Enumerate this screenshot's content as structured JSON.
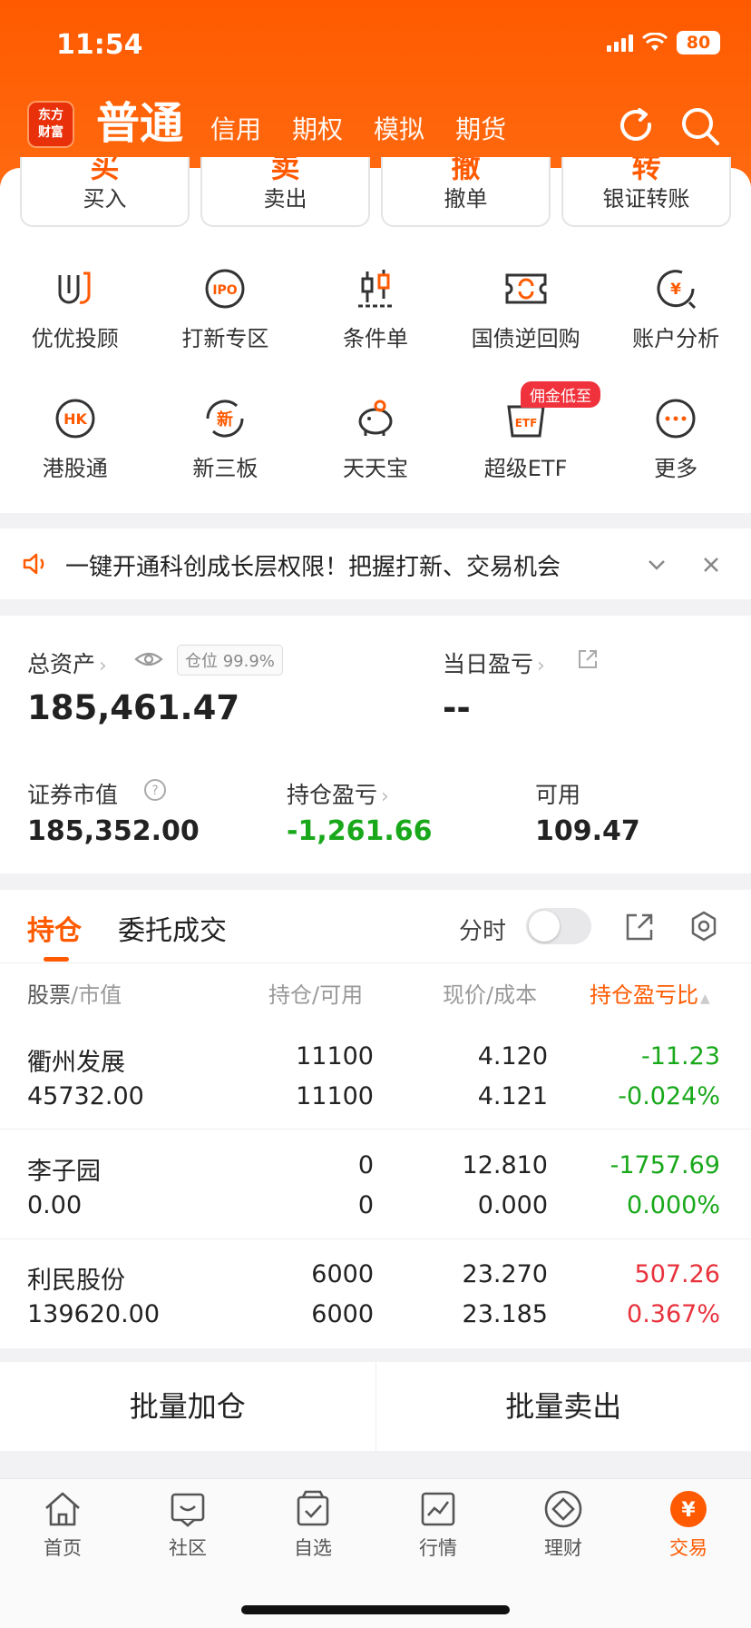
{
  "status": {
    "time": "11:54",
    "battery": "80"
  },
  "brand": {
    "line1": "东方",
    "line2": "财富"
  },
  "header": {
    "tabs": [
      "普通",
      "信用",
      "期权",
      "模拟",
      "期货"
    ]
  },
  "trade_buttons": [
    {
      "glyph": "买",
      "label": "买入"
    },
    {
      "glyph": "卖",
      "label": "卖出"
    },
    {
      "glyph": "撤",
      "label": "撤单"
    },
    {
      "glyph": "转",
      "label": "银证转账"
    }
  ],
  "features": [
    {
      "label": "优优投顾",
      "icon": "advisor-icon"
    },
    {
      "label": "打新专区",
      "icon": "ipo-icon",
      "icon_text": "IPO"
    },
    {
      "label": "条件单",
      "icon": "candlestick-icon"
    },
    {
      "label": "国债逆回购",
      "icon": "repo-icon"
    },
    {
      "label": "账户分析",
      "icon": "account-analysis-icon",
      "icon_text": "¥"
    },
    {
      "label": "港股通",
      "icon": "hk-icon",
      "icon_text": "HK"
    },
    {
      "label": "新三板",
      "icon": "new-third-board-icon",
      "icon_text": "新"
    },
    {
      "label": "天天宝",
      "icon": "piggy-bank-icon"
    },
    {
      "label": "超级ETF",
      "icon": "etf-icon",
      "icon_text": "ETF"
    },
    {
      "label": "更多",
      "icon": "more-icon"
    }
  ],
  "etf_badge": "佣金低至",
  "notice": {
    "text": "一键开通科创成长层权限！把握打新、交易机会"
  },
  "assets": {
    "total_label": "总资产",
    "position_tag": "仓位 99.9%",
    "total_value": "185,461.47",
    "daily_pl_label": "当日盈亏",
    "daily_pl_value": "--",
    "market_value_label": "证券市值",
    "market_value": "185,352.00",
    "holding_pl_label": "持仓盈亏",
    "holding_pl": "-1,261.66",
    "available_label": "可用",
    "available": "109.47"
  },
  "holdings_tabs": {
    "holdings": "持仓",
    "orders": "委托成交",
    "intraday": "分时"
  },
  "table": {
    "headers": {
      "stock": "股票",
      "market_value": "市值",
      "position": "持仓",
      "available": "可用",
      "price": "现价",
      "cost": "成本",
      "pl_ratio": "持仓盈亏比"
    },
    "rows": [
      {
        "name": "衢州发展",
        "market_value": "45732.00",
        "position": "11100",
        "available": "11100",
        "price": "4.120",
        "cost": "4.121",
        "pl": "-11.23",
        "pl_pct": "-0.024%",
        "color": "#18a81a"
      },
      {
        "name": "李子园",
        "market_value": "0.00",
        "position": "0",
        "available": "0",
        "price": "12.810",
        "cost": "0.000",
        "pl": "-1757.69",
        "pl_pct": "0.000%",
        "color": "#18a81a"
      },
      {
        "name": "利民股份",
        "market_value": "139620.00",
        "position": "6000",
        "available": "6000",
        "price": "23.270",
        "cost": "23.185",
        "pl": "507.26",
        "pl_pct": "0.367%",
        "color": "#e8323c"
      }
    ]
  },
  "batch": {
    "add": "批量加仓",
    "sell": "批量卖出"
  },
  "nav": [
    {
      "label": "首页",
      "icon": "home-icon"
    },
    {
      "label": "社区",
      "icon": "community-icon"
    },
    {
      "label": "自选",
      "icon": "watchlist-icon"
    },
    {
      "label": "行情",
      "icon": "market-icon"
    },
    {
      "label": "理财",
      "icon": "wealth-icon"
    },
    {
      "label": "交易",
      "icon": "trade-icon",
      "active": true
    }
  ],
  "colors": {
    "accent": "#ff5a00",
    "gain": "#e8323c",
    "loss": "#18a81a"
  }
}
